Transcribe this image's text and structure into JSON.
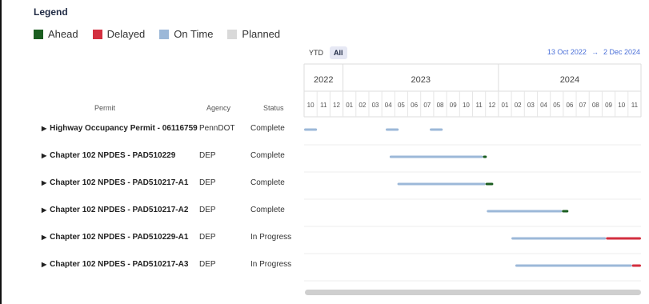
{
  "legend": {
    "title": "Legend",
    "items": [
      {
        "label": "Ahead",
        "color": "#1b5e20"
      },
      {
        "label": "Delayed",
        "color": "#d32f3f"
      },
      {
        "label": "On Time",
        "color": "#9cb8d8"
      },
      {
        "label": "Planned",
        "color": "#d9d9d9"
      }
    ]
  },
  "toolbar": {
    "ytd_label": "YTD",
    "all_label": "All",
    "date_start": "13 Oct 2022",
    "date_arrow": "→",
    "date_end": "2 Dec 2024"
  },
  "columns": {
    "permit": "Permit",
    "agency": "Agency",
    "status": "Status"
  },
  "timeline": {
    "years": [
      {
        "label": "2022",
        "months": 3
      },
      {
        "label": "2023",
        "months": 12
      },
      {
        "label": "2024",
        "months": 11
      }
    ],
    "months": [
      "10",
      "11",
      "12",
      "01",
      "02",
      "03",
      "04",
      "05",
      "06",
      "07",
      "08",
      "09",
      "10",
      "11",
      "12",
      "01",
      "02",
      "03",
      "04",
      "05",
      "06",
      "07",
      "08",
      "09",
      "10",
      "11"
    ]
  },
  "rows": [
    {
      "permit": "Highway Occupancy Permit - 06116759",
      "agency": "PennDOT",
      "status": "Complete",
      "segments": [
        [
          0.0,
          1.0,
          "on_time"
        ],
        [
          6.3,
          7.3,
          "on_time"
        ],
        [
          9.7,
          10.7,
          "on_time"
        ]
      ]
    },
    {
      "permit": "Chapter 102 NPDES - PAD510229",
      "agency": "DEP",
      "status": "Complete",
      "segments": [
        [
          6.6,
          13.8,
          "on_time"
        ],
        [
          13.8,
          14.1,
          "ahead"
        ]
      ]
    },
    {
      "permit": "Chapter 102 NPDES - PAD510217-A1",
      "agency": "DEP",
      "status": "Complete",
      "segments": [
        [
          7.2,
          14.0,
          "on_time"
        ],
        [
          14.0,
          14.6,
          "ahead"
        ]
      ]
    },
    {
      "permit": "Chapter 102 NPDES - PAD510217-A2",
      "agency": "DEP",
      "status": "Complete",
      "segments": [
        [
          14.1,
          19.9,
          "on_time"
        ],
        [
          19.9,
          20.4,
          "ahead"
        ]
      ]
    },
    {
      "permit": "Chapter 102 NPDES - PAD510229-A1",
      "agency": "DEP",
      "status": "In Progress",
      "segments": [
        [
          16.0,
          23.3,
          "on_time"
        ],
        [
          23.3,
          26.0,
          "delayed"
        ]
      ]
    },
    {
      "permit": "Chapter 102 NPDES - PAD510217-A3",
      "agency": "DEP",
      "status": "In Progress",
      "segments": [
        [
          16.3,
          25.3,
          "on_time"
        ],
        [
          25.3,
          26.0,
          "delayed"
        ]
      ]
    }
  ]
}
